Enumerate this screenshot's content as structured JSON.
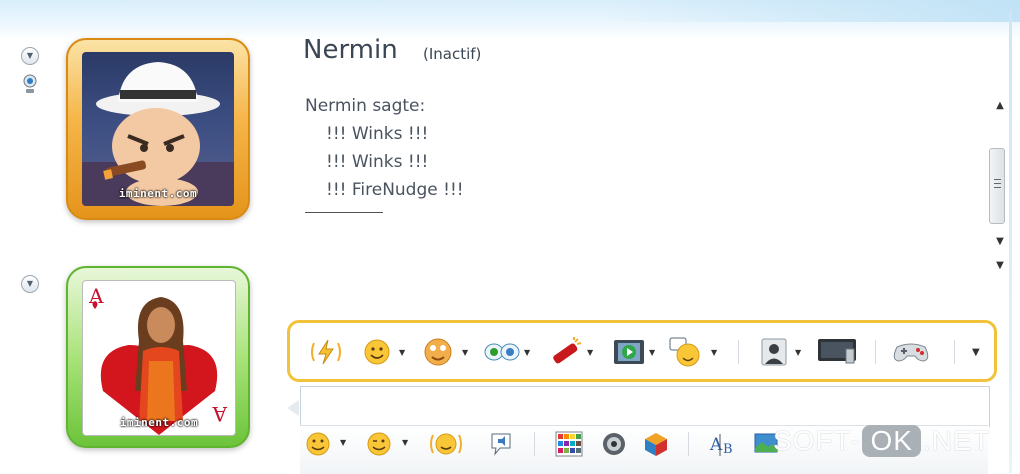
{
  "contact": {
    "name": "Nermin",
    "status": "(Inactif)"
  },
  "conversation": {
    "sender_line": "Nermin sagte:",
    "messages": [
      "!!! Winks !!!",
      "!!! Winks !!!",
      "!!! FireNudge !!!"
    ]
  },
  "avatars": {
    "contact_watermark": "iminent.com",
    "self_watermark": "iminent.com",
    "contact_frame_color": "#f0a326",
    "self_frame_color": "#79c94a"
  },
  "toolbar": {
    "highlight_color": "#f2c23a",
    "items": [
      {
        "name": "nudge-icon",
        "has_dropdown": false
      },
      {
        "name": "emoticon-icon",
        "has_dropdown": true
      },
      {
        "name": "wink-icon",
        "has_dropdown": true
      },
      {
        "name": "eyes-icon",
        "has_dropdown": true
      },
      {
        "name": "firecracker-icon",
        "has_dropdown": true
      },
      {
        "name": "video-icon",
        "has_dropdown": true
      },
      {
        "name": "speech-emoticon-icon",
        "has_dropdown": true
      },
      {
        "name": "contact-card-icon",
        "has_dropdown": true
      },
      {
        "name": "monitor-icon",
        "has_dropdown": false
      },
      {
        "name": "gamepad-icon",
        "has_dropdown": false
      }
    ]
  },
  "bottom_toolbar": {
    "items": [
      {
        "name": "emoticon-icon",
        "has_dropdown": true
      },
      {
        "name": "wink-icon",
        "has_dropdown": true
      },
      {
        "name": "nudge-icon",
        "has_dropdown": false
      },
      {
        "name": "voice-clip-icon",
        "has_dropdown": false
      },
      {
        "name": "color-palette-icon",
        "has_dropdown": false
      },
      {
        "name": "sound-icon",
        "has_dropdown": false
      },
      {
        "name": "cube-icon",
        "has_dropdown": false
      },
      {
        "name": "spellcheck-icon",
        "has_dropdown": false
      },
      {
        "name": "picture-icon",
        "has_dropdown": false
      }
    ]
  },
  "site_watermark": {
    "part1": "SOFT-",
    "part2": "OK",
    "part3": ".NET"
  }
}
